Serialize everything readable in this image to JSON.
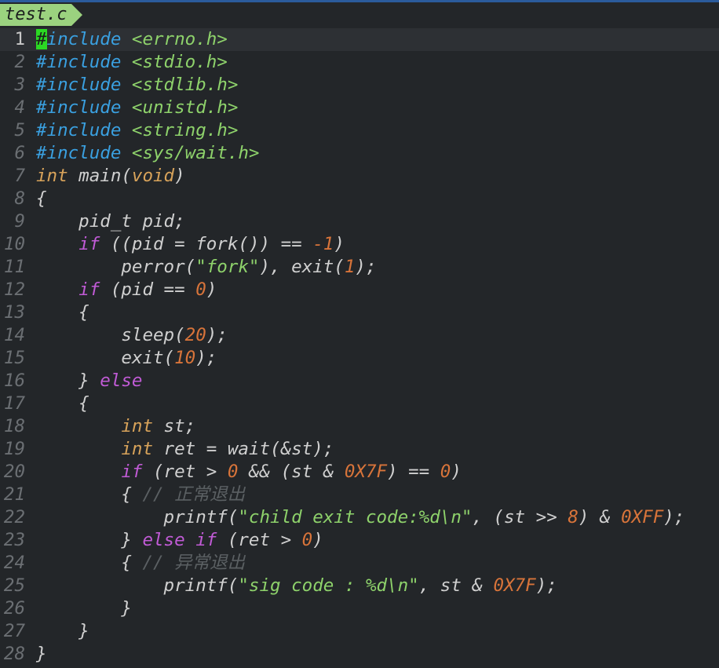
{
  "tab": {
    "filename": "test.c"
  },
  "colors": {
    "background": "#232629",
    "tab": "#9bd27f",
    "preprocessor": "#3aa0e0",
    "type": "#d8a35a",
    "keyword": "#c15bd6",
    "string": "#8ed26b",
    "number": "#d8743a",
    "comment": "#5b6063",
    "cursor": "#2bd923"
  },
  "lines": [
    {
      "num": "1",
      "current": true,
      "tokens": [
        {
          "t": "#",
          "c": "cursor"
        },
        {
          "t": "include",
          "c": "pre"
        },
        {
          "t": " <errno.h>",
          "c": "str"
        }
      ]
    },
    {
      "num": "2",
      "tokens": [
        {
          "t": "#include",
          "c": "pre"
        },
        {
          "t": " <stdio.h>",
          "c": "str"
        }
      ]
    },
    {
      "num": "3",
      "tokens": [
        {
          "t": "#include",
          "c": "pre"
        },
        {
          "t": " <stdlib.h>",
          "c": "str"
        }
      ]
    },
    {
      "num": "4",
      "tokens": [
        {
          "t": "#include",
          "c": "pre"
        },
        {
          "t": " <unistd.h>",
          "c": "str"
        }
      ]
    },
    {
      "num": "5",
      "tokens": [
        {
          "t": "#include",
          "c": "pre"
        },
        {
          "t": " <string.h>",
          "c": "str"
        }
      ]
    },
    {
      "num": "6",
      "tokens": [
        {
          "t": "#include",
          "c": "pre"
        },
        {
          "t": " <sys/wait.h>",
          "c": "str"
        }
      ]
    },
    {
      "num": "7",
      "tokens": [
        {
          "t": "int",
          "c": "type"
        },
        {
          "t": " main(",
          "c": "plain"
        },
        {
          "t": "void",
          "c": "type"
        },
        {
          "t": ")",
          "c": "plain"
        }
      ]
    },
    {
      "num": "8",
      "tokens": [
        {
          "t": "{",
          "c": "plain"
        }
      ]
    },
    {
      "num": "9",
      "tokens": [
        {
          "t": "    pid_t pid;",
          "c": "plain"
        }
      ]
    },
    {
      "num": "10",
      "tokens": [
        {
          "t": "    ",
          "c": "plain"
        },
        {
          "t": "if",
          "c": "kw"
        },
        {
          "t": " ((pid = fork()) == ",
          "c": "plain"
        },
        {
          "t": "-1",
          "c": "num"
        },
        {
          "t": ")",
          "c": "plain"
        }
      ]
    },
    {
      "num": "11",
      "tokens": [
        {
          "t": "        perror(",
          "c": "plain"
        },
        {
          "t": "\"fork\"",
          "c": "str"
        },
        {
          "t": "), exit(",
          "c": "plain"
        },
        {
          "t": "1",
          "c": "num"
        },
        {
          "t": ");",
          "c": "plain"
        }
      ]
    },
    {
      "num": "12",
      "tokens": [
        {
          "t": "    ",
          "c": "plain"
        },
        {
          "t": "if",
          "c": "kw"
        },
        {
          "t": " (pid == ",
          "c": "plain"
        },
        {
          "t": "0",
          "c": "num"
        },
        {
          "t": ")",
          "c": "plain"
        }
      ]
    },
    {
      "num": "13",
      "tokens": [
        {
          "t": "    {",
          "c": "plain"
        }
      ]
    },
    {
      "num": "14",
      "tokens": [
        {
          "t": "        sleep(",
          "c": "plain"
        },
        {
          "t": "20",
          "c": "num"
        },
        {
          "t": ");",
          "c": "plain"
        }
      ]
    },
    {
      "num": "15",
      "tokens": [
        {
          "t": "        exit(",
          "c": "plain"
        },
        {
          "t": "10",
          "c": "num"
        },
        {
          "t": ");",
          "c": "plain"
        }
      ]
    },
    {
      "num": "16",
      "tokens": [
        {
          "t": "    } ",
          "c": "plain"
        },
        {
          "t": "else",
          "c": "kw"
        }
      ]
    },
    {
      "num": "17",
      "tokens": [
        {
          "t": "    {",
          "c": "plain"
        }
      ]
    },
    {
      "num": "18",
      "tokens": [
        {
          "t": "        ",
          "c": "plain"
        },
        {
          "t": "int",
          "c": "type"
        },
        {
          "t": " st;",
          "c": "plain"
        }
      ]
    },
    {
      "num": "19",
      "tokens": [
        {
          "t": "        ",
          "c": "plain"
        },
        {
          "t": "int",
          "c": "type"
        },
        {
          "t": " ret = wait(&st);",
          "c": "plain"
        }
      ]
    },
    {
      "num": "20",
      "tokens": [
        {
          "t": "        ",
          "c": "plain"
        },
        {
          "t": "if",
          "c": "kw"
        },
        {
          "t": " (ret > ",
          "c": "plain"
        },
        {
          "t": "0",
          "c": "num"
        },
        {
          "t": " && (st & ",
          "c": "plain"
        },
        {
          "t": "0X7F",
          "c": "num"
        },
        {
          "t": ") == ",
          "c": "plain"
        },
        {
          "t": "0",
          "c": "num"
        },
        {
          "t": ")",
          "c": "plain"
        }
      ]
    },
    {
      "num": "21",
      "tokens": [
        {
          "t": "        { ",
          "c": "plain"
        },
        {
          "t": "// 正常退出",
          "c": "cmt"
        }
      ]
    },
    {
      "num": "22",
      "tokens": [
        {
          "t": "            printf(",
          "c": "plain"
        },
        {
          "t": "\"child exit code:%d\\n\"",
          "c": "str"
        },
        {
          "t": ", (st >> ",
          "c": "plain"
        },
        {
          "t": "8",
          "c": "num"
        },
        {
          "t": ") & ",
          "c": "plain"
        },
        {
          "t": "0XFF",
          "c": "num"
        },
        {
          "t": ");",
          "c": "plain"
        }
      ]
    },
    {
      "num": "23",
      "tokens": [
        {
          "t": "        } ",
          "c": "plain"
        },
        {
          "t": "else if",
          "c": "kw"
        },
        {
          "t": " (ret > ",
          "c": "plain"
        },
        {
          "t": "0",
          "c": "num"
        },
        {
          "t": ")",
          "c": "plain"
        }
      ]
    },
    {
      "num": "24",
      "tokens": [
        {
          "t": "        { ",
          "c": "plain"
        },
        {
          "t": "// 异常退出",
          "c": "cmt"
        }
      ]
    },
    {
      "num": "25",
      "tokens": [
        {
          "t": "            printf(",
          "c": "plain"
        },
        {
          "t": "\"sig code : %d\\n\"",
          "c": "str"
        },
        {
          "t": ", st & ",
          "c": "plain"
        },
        {
          "t": "0X7F",
          "c": "num"
        },
        {
          "t": ");",
          "c": "plain"
        }
      ]
    },
    {
      "num": "26",
      "tokens": [
        {
          "t": "        }",
          "c": "plain"
        }
      ]
    },
    {
      "num": "27",
      "tokens": [
        {
          "t": "    }",
          "c": "plain"
        }
      ]
    },
    {
      "num": "28",
      "tokens": [
        {
          "t": "}",
          "c": "plain"
        }
      ]
    }
  ]
}
